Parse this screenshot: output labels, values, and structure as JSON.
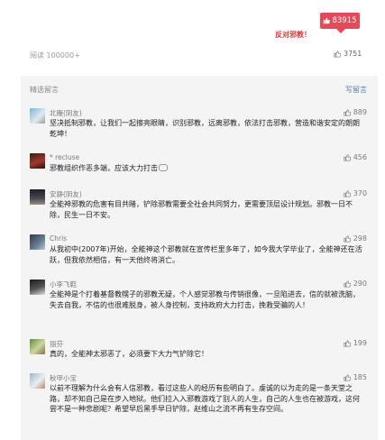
{
  "header": {
    "like_badge_count": "83915",
    "slogan": "反对邪教！",
    "reads": "阅读 100000+",
    "like_count": "3751"
  },
  "comments_section": {
    "title": "精选留言",
    "write_label": "写留言",
    "items": [
      {
        "nickname": "北雁(阴友)",
        "likes": "889",
        "text": "坚决抵制邪教，让我们一起擦亮眼睛，识别邪教，远离邪教，依法打击邪教，营造和谐安定的朗朗乾坤！"
      },
      {
        "nickname": "* recluse",
        "likes": "456",
        "text": "邪教组织作恶多端，应该大力打击"
      },
      {
        "nickname": "安静(阴友)",
        "likes": "370",
        "text": "全能神邪教的危害有目共睹，铲除邪教需要全社会共同努力，更需要顶层设计规划。邪教一日不除，民生一日不安。"
      },
      {
        "nickname": "Chris",
        "likes": "298",
        "text": "从我初中(2007年)开始，全能神这个邪教就在宣传栏里多年了，如今我大学毕业了，全能神还在活跃，但我依然相信，有一天他终将消亡。"
      },
      {
        "nickname": "小李飞鞋",
        "likes": "290",
        "text": "全能神是个打着基督教幌子的邪教无疑，个人感觉邪教与传销很像，一旦陷进去，信的就被洗脑，失去自我，不信的也很难脱身，被人身控制，支持政府大力打击，挽救受骗的人！"
      },
      {
        "nickname": "丽芬",
        "likes": "199",
        "text": "真的，全能神太邪恶了，必须要下大力气铲除它！"
      },
      {
        "nickname": "秋甲小宝",
        "likes": "185",
        "text": "以前不理解为什么会有人信邪教，看过这些人的经历有些明白了。虔诚的以为走的是一条天堂之路，却不知自己是在步入地狱。他们拉入入邪教游戏了别人的人生，自己的人生也在被游戏，这何尝不是一种悲剧呢？希望早后黑手早日铲除，赵维山之流不再有生存空间。"
      }
    ]
  },
  "colors": {
    "accent": "#e64a5a",
    "slogan": "#e23a3a",
    "link": "#5a7db0",
    "panel_bg": "#f4f4f4"
  }
}
